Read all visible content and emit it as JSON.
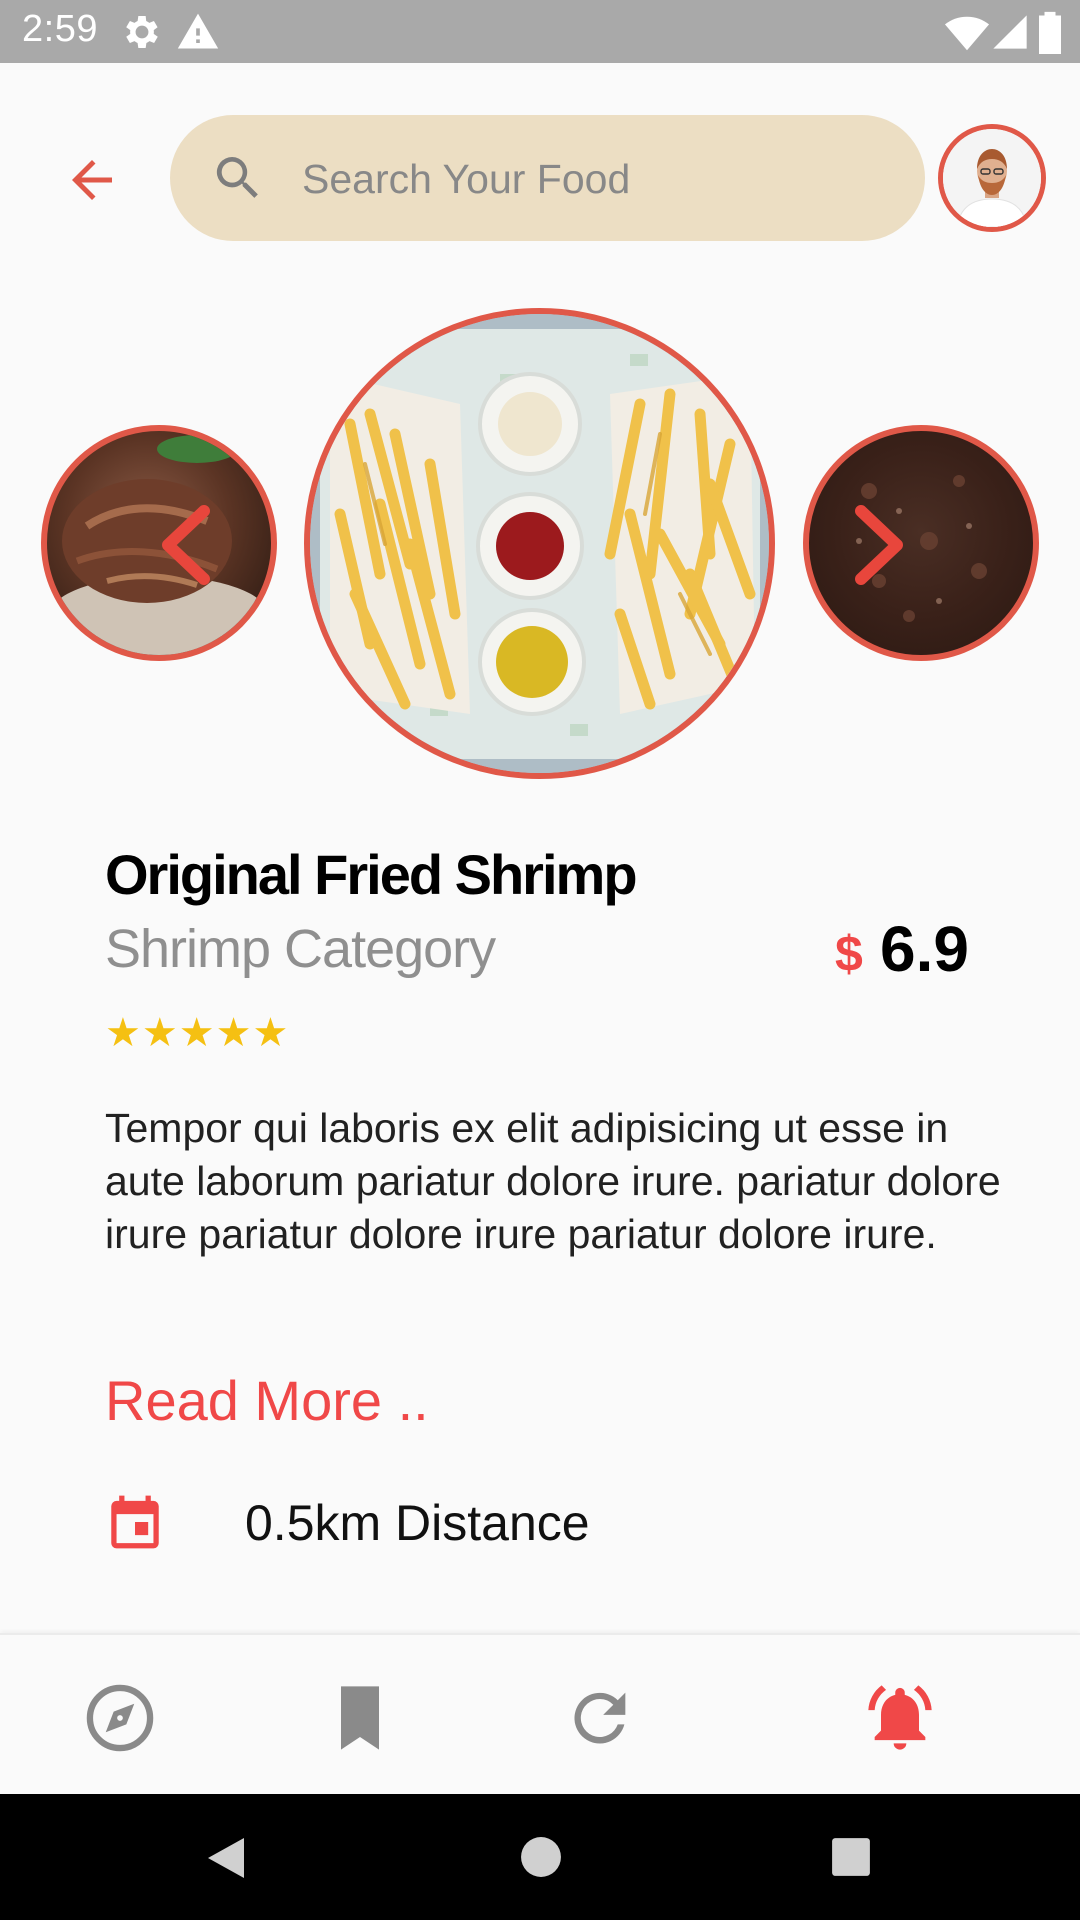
{
  "status_bar": {
    "time": "2:59",
    "icons": [
      "gear-icon",
      "warning-icon",
      "wifi-icon",
      "signal-icon",
      "battery-icon"
    ]
  },
  "header": {
    "back_icon": "arrow-back-icon",
    "search": {
      "placeholder": "Search Your Food",
      "value": "",
      "icon": "search-icon"
    },
    "avatar_icon": "avatar"
  },
  "carousel": {
    "prev_icon": "chevron-left-icon",
    "next_icon": "chevron-right-icon"
  },
  "item": {
    "title": "Original Fried Shrimp",
    "category": "Shrimp Category",
    "currency": "$",
    "price": "6.9",
    "rating": 5,
    "rating_max": 5,
    "description": "Tempor qui laboris ex elit adipisicing ut esse in aute laborum pariatur dolore irure. pariatur dolore irure pariatur dolore irure pariatur dolore irure.",
    "read_more": "Read More ..",
    "distance": "0.5km Distance",
    "distance_icon": "calendar-icon"
  },
  "bottom_nav": {
    "items": [
      {
        "icon": "compass-icon",
        "active": false
      },
      {
        "icon": "bookmark-icon",
        "active": false
      },
      {
        "icon": "refresh-icon",
        "active": false
      },
      {
        "icon": "bell-ringing-icon",
        "active": true
      }
    ]
  },
  "colors": {
    "accent": "#f04848",
    "border_red": "#e05848",
    "search_bg": "#ecdec3",
    "star": "#f5c012",
    "inactive_icon": "#8a8a8a"
  }
}
